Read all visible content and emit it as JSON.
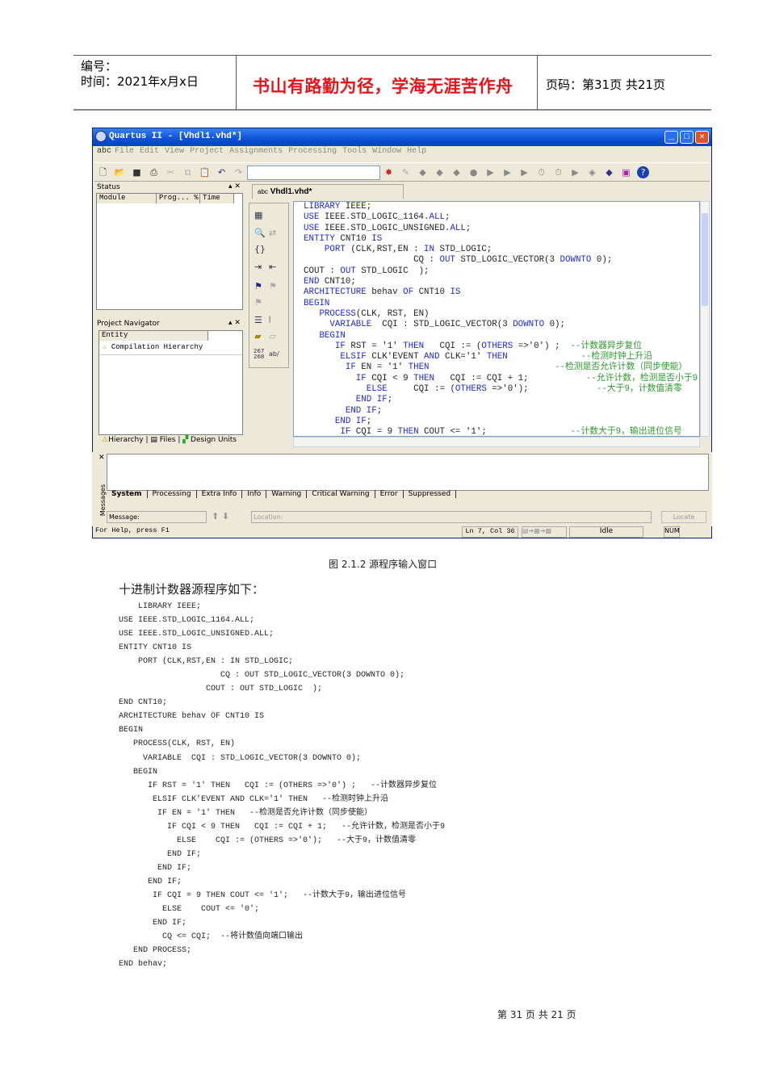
{
  "header": {
    "number_label": "编号：",
    "time_label": "时间：2021年x月x日",
    "motto": "书山有路勤为径，学海无涯苦作舟",
    "page_label": "页码：第31页 共21页"
  },
  "window": {
    "title": "Quartus II - [Vhdl1.vhd*]",
    "menu": [
      "File",
      "Edit",
      "View",
      "Project",
      "Assignments",
      "Processing",
      "Tools",
      "Window",
      "Help"
    ],
    "status_pane": {
      "title": "Status",
      "columns": [
        "Module",
        "Prog...  %",
        "Time"
      ]
    },
    "navigator": {
      "title": "Project Navigator",
      "column": "Entity",
      "item": "Compilation Hierarchy",
      "tabs": [
        "Hierarchy",
        "Files",
        "Design Units"
      ]
    },
    "editor_tab": "Vhdl1.vhd*",
    "side_numbers": "267\n268",
    "code": [
      [
        [
          "LIBRARY",
          "k"
        ],
        [
          " IEEE;",
          ""
        ]
      ],
      [
        [
          "USE",
          "k"
        ],
        [
          " IEEE.STD_LOGIC_1164.",
          ""
        ],
        [
          "ALL",
          "k"
        ],
        [
          ";",
          ""
        ]
      ],
      [
        [
          "USE",
          "k"
        ],
        [
          " IEEE.STD_LOGIC_UNSIGNED.",
          ""
        ],
        [
          "ALL",
          "k"
        ],
        [
          ";",
          ""
        ]
      ],
      [
        [
          "ENTITY",
          "k"
        ],
        [
          " CNT10 ",
          ""
        ],
        [
          "IS",
          "k"
        ]
      ],
      [
        [
          "    ",
          ""
        ],
        [
          "PORT",
          "k"
        ],
        [
          " (CLK,RST,EN : ",
          ""
        ],
        [
          "IN",
          "k"
        ],
        [
          " STD_LOGIC;",
          ""
        ]
      ],
      [
        [
          "                     CQ : ",
          ""
        ],
        [
          "OUT",
          "k"
        ],
        [
          " STD_LOGIC_VECTOR(3 ",
          ""
        ],
        [
          "DOWNTO",
          "k"
        ],
        [
          " 0);",
          ""
        ]
      ],
      [
        [
          "COUT : ",
          ""
        ],
        [
          "OUT",
          "k"
        ],
        [
          " STD_LOGIC  );",
          ""
        ]
      ],
      [
        [
          "END",
          "k"
        ],
        [
          " CNT10;",
          ""
        ]
      ],
      [
        [
          "ARCHITECTURE",
          "k"
        ],
        [
          " behav ",
          ""
        ],
        [
          "OF",
          "k"
        ],
        [
          " CNT10 ",
          ""
        ],
        [
          "IS",
          "k"
        ]
      ],
      [
        [
          "BEGIN",
          "k"
        ]
      ],
      [
        [
          "   ",
          ""
        ],
        [
          "PROCESS",
          "k"
        ],
        [
          "(CLK, RST, EN)",
          ""
        ]
      ],
      [
        [
          "     ",
          ""
        ],
        [
          "VARIABLE",
          "k"
        ],
        [
          "  CQI : STD_LOGIC_VECTOR(3 ",
          ""
        ],
        [
          "DOWNTO",
          "k"
        ],
        [
          " 0);",
          ""
        ]
      ],
      [
        [
          "   ",
          ""
        ],
        [
          "BEGIN",
          "k"
        ]
      ],
      [
        [
          "      ",
          ""
        ],
        [
          "IF",
          "k"
        ],
        [
          " RST = '1' ",
          ""
        ],
        [
          "THEN",
          "k"
        ],
        [
          "   CQI := (",
          ""
        ],
        [
          "OTHERS",
          "k"
        ],
        [
          " =>'0') ;  ",
          ""
        ],
        [
          "--计数器异步复位",
          "c"
        ]
      ],
      [
        [
          "       ",
          ""
        ],
        [
          "ELSIF",
          "k"
        ],
        [
          " CLK'EVENT ",
          ""
        ],
        [
          "AND",
          "k"
        ],
        [
          " CLK='1' ",
          ""
        ],
        [
          "THEN",
          "k"
        ],
        [
          "              ",
          ""
        ],
        [
          "--检测时钟上升沿",
          "c"
        ]
      ],
      [
        [
          "        ",
          ""
        ],
        [
          "IF",
          "k"
        ],
        [
          " EN = '1' ",
          ""
        ],
        [
          "THEN",
          "k"
        ],
        [
          "                        ",
          ""
        ],
        [
          "--检测是否允许计数（同步使能）",
          "c"
        ]
      ],
      [
        [
          "          ",
          ""
        ],
        [
          "IF",
          "k"
        ],
        [
          " CQI < 9 ",
          ""
        ],
        [
          "THEN",
          "k"
        ],
        [
          "   CQI := CQI + 1;           ",
          ""
        ],
        [
          "--允许计数，检测是否小于9",
          "c"
        ]
      ],
      [
        [
          "            ",
          ""
        ],
        [
          "ELSE",
          "k"
        ],
        [
          "     CQI := (",
          ""
        ],
        [
          "OTHERS",
          "k"
        ],
        [
          " =>'0');             ",
          ""
        ],
        [
          "--大于9，计数值清零",
          "c"
        ]
      ],
      [
        [
          "          ",
          ""
        ],
        [
          "END IF",
          "k"
        ],
        [
          ";",
          ""
        ]
      ],
      [
        [
          "        ",
          ""
        ],
        [
          "END IF",
          "k"
        ],
        [
          ";",
          ""
        ]
      ],
      [
        [
          "      ",
          ""
        ],
        [
          "END IF",
          "k"
        ],
        [
          ";",
          ""
        ]
      ],
      [
        [
          "       ",
          ""
        ],
        [
          "IF",
          "k"
        ],
        [
          " CQI = 9 ",
          ""
        ],
        [
          "THEN",
          "k"
        ],
        [
          " COUT <= '1';                ",
          ""
        ],
        [
          "--计数大于9，输出进位信号",
          "c"
        ]
      ]
    ],
    "messages": {
      "side_label": "Messages",
      "tabs": [
        "System",
        "Processing",
        "Extra Info",
        "Info",
        "Warning",
        "Critical Warning",
        "Error",
        "Suppressed"
      ],
      "message_label": "Message:",
      "location_placeholder": "Location:",
      "locate_button": "Locate"
    },
    "statusbar": {
      "help": "For Help, press F1",
      "position": "Ln 7, Col 36",
      "state": "Idle",
      "num": "NUM"
    }
  },
  "caption": "图 2.1.2 源程序输入窗口",
  "intro": "十进制计数器源程序如下：",
  "listing": [
    "    LIBRARY IEEE;",
    "USE IEEE.STD_LOGIC_1164.ALL;",
    "USE IEEE.STD_LOGIC_UNSIGNED.ALL;",
    "ENTITY CNT10 IS",
    "    PORT (CLK,RST,EN : IN STD_LOGIC;",
    "                     CQ : OUT STD_LOGIC_VECTOR(3 DOWNTO 0);",
    "                  COUT : OUT STD_LOGIC  );",
    "END CNT10;",
    "ARCHITECTURE behav OF CNT10 IS",
    "BEGIN",
    "   PROCESS(CLK, RST, EN)",
    "     VARIABLE  CQI : STD_LOGIC_VECTOR(3 DOWNTO 0);",
    "   BEGIN",
    "      IF RST = '1' THEN   CQI := (OTHERS =>'0') ;   --计数器异步复位",
    "       ELSIF CLK'EVENT AND CLK='1' THEN   --检测时钟上升沿",
    "        IF EN = '1' THEN   --检测是否允许计数（同步使能）",
    "          IF CQI < 9 THEN   CQI := CQI + 1;   --允许计数，检测是否小于9",
    "            ELSE    CQI := (OTHERS =>'0');   --大于9，计数值清零",
    "          END IF;",
    "        END IF;",
    "      END IF;",
    "       IF CQI = 9 THEN COUT <= '1';   --计数大于9，输出进位信号",
    "         ELSE    COUT <= '0';",
    "       END IF;",
    "         CQ <= CQI;  --将计数值向端口输出",
    "   END PROCESS;",
    "END behav;"
  ],
  "footer": "第 31 页 共 21 页"
}
